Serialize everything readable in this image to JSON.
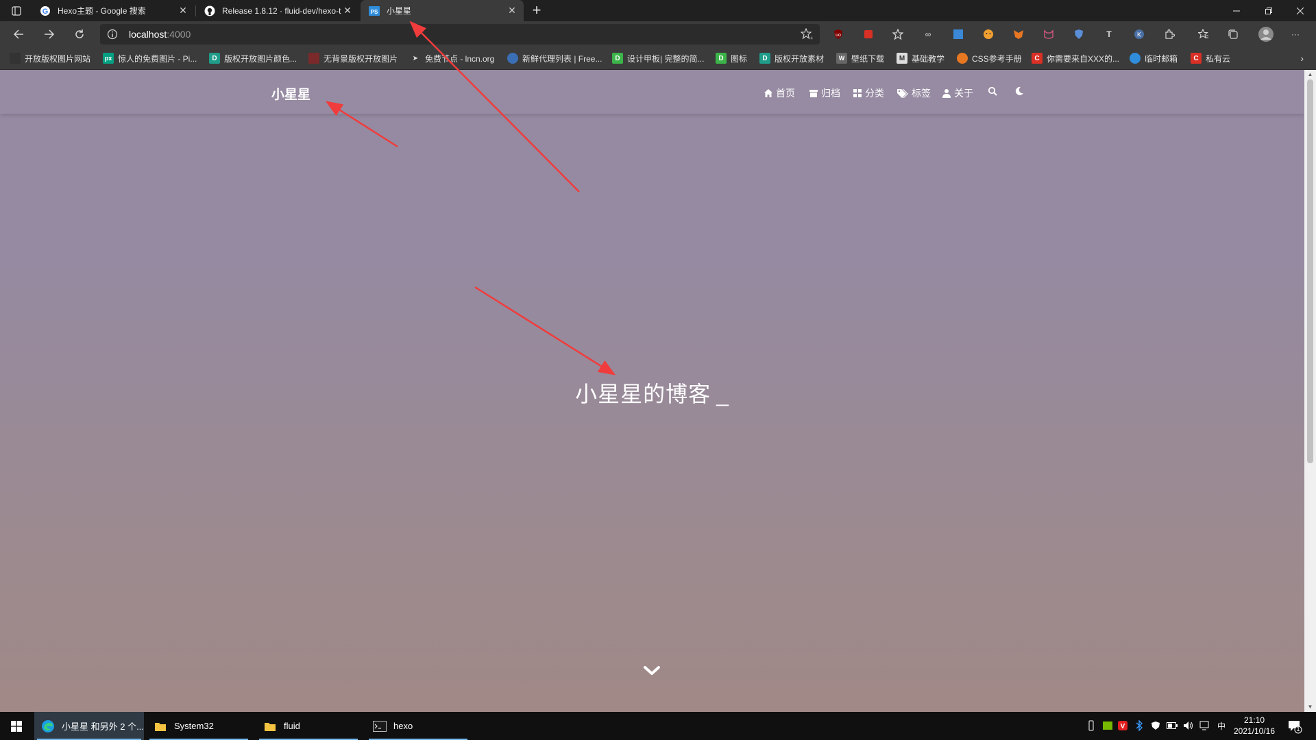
{
  "browser": {
    "tabs": [
      {
        "title": "Hexo主题 - Google 搜索",
        "icon": "google-icon"
      },
      {
        "title": "Release 1.8.12 · fluid-dev/hexo-t",
        "icon": "github-icon"
      },
      {
        "title": "小星星",
        "icon": "site-favicon",
        "active": true
      }
    ],
    "address": {
      "host": "localhost",
      "port": ":4000"
    },
    "bookmarks": [
      "开放版权图片网站",
      "惊人的免费图片 - Pi...",
      "版权开放图片颜色...",
      "无背景版权开放图片",
      "免费节点 - lncn.org",
      "新鲜代理列表 | Free...",
      "设计甲板| 完整的简...",
      "图标",
      "版权开放素材",
      "壁纸下载",
      "基础教学",
      "CSS参考手册",
      "你需要来自XXX的...",
      "临时邮箱",
      "私有云"
    ]
  },
  "site": {
    "brand": "小星星",
    "nav": {
      "home": "首页",
      "archives": "归档",
      "categories": "分类",
      "tags": "标签",
      "about": "关于"
    },
    "hero_title": "小星星的博客",
    "hero_cursor": "_"
  },
  "taskbar": {
    "apps": [
      {
        "label": "小星星 和另外 2 个...",
        "icon": "edge-icon"
      },
      {
        "label": "System32",
        "icon": "folder-icon"
      },
      {
        "label": "fluid",
        "icon": "folder-icon"
      },
      {
        "label": "hexo",
        "icon": "terminal-icon"
      }
    ],
    "ime": "中",
    "time": "21:10",
    "date": "2021/10/16",
    "notification_count": "1"
  },
  "colors": {
    "annotation_arrow": "#f03c3c",
    "page_top": "#958aa2",
    "page_bottom": "#a08986"
  }
}
